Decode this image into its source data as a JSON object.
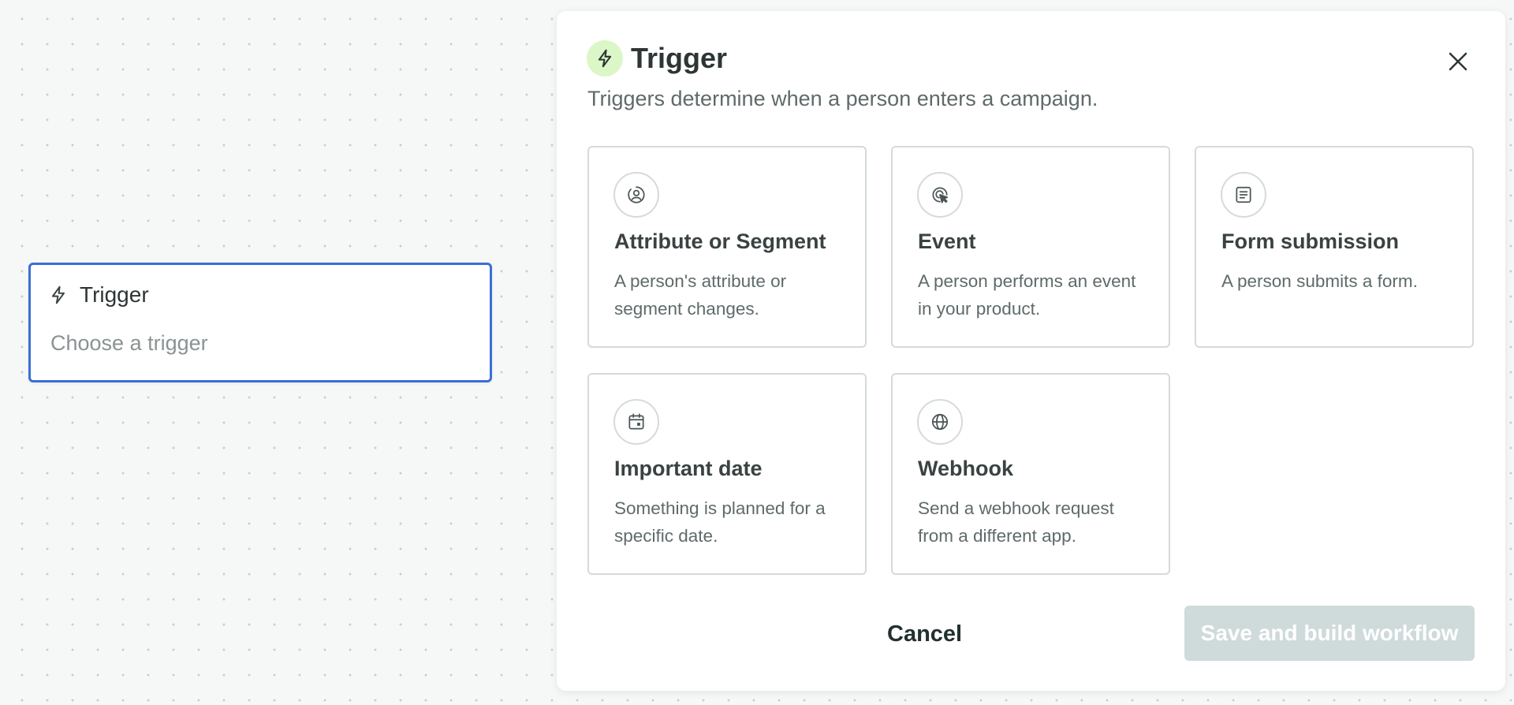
{
  "canvas": {
    "node": {
      "icon": "bolt-icon",
      "title": "Trigger",
      "placeholder": "Choose a trigger"
    }
  },
  "modal": {
    "icon": "bolt-icon",
    "icon_bg_color": "#dcf7c7",
    "title": "Trigger",
    "subtitle": "Triggers determine when a person enters a campaign.",
    "close_icon": "close-icon",
    "options": [
      {
        "icon": "person-circle-icon",
        "title": "Attribute or Segment",
        "description": "A person's attribute or segment changes."
      },
      {
        "icon": "cursor-click-icon",
        "title": "Event",
        "description": "A person performs an event in your product."
      },
      {
        "icon": "form-icon",
        "title": "Form submission",
        "description": "A person submits a form."
      },
      {
        "icon": "calendar-icon",
        "title": "Important date",
        "description": "Something is planned for a specific date."
      },
      {
        "icon": "globe-icon",
        "title": "Webhook",
        "description": "Send a webhook request from a different app."
      }
    ],
    "footer": {
      "cancel_label": "Cancel",
      "save_label": "Save and build workflow",
      "save_disabled": true
    }
  },
  "colors": {
    "selection_border": "#3a6fd6",
    "disabled_button": "#cfdada"
  }
}
